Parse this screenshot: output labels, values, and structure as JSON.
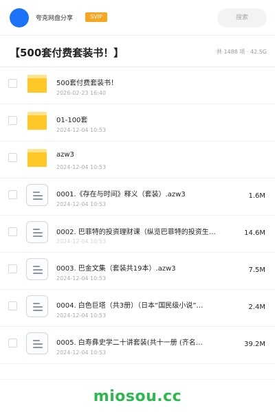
{
  "header": {
    "sharer_name": "夸克网盘分享",
    "vip_badge": "SVIP",
    "search_placeholder": "搜索",
    "accent_color": "#1a73f8"
  },
  "folder": {
    "title": "【500套付费套装书！】",
    "summary": "共 1488 项 · 42.5G"
  },
  "files": [
    {
      "icon": "folder-icon",
      "name": "500套付费套装书！",
      "date": "2026-02-23 16:40",
      "size": ""
    },
    {
      "icon": "folder-icon",
      "name": "01-100套",
      "date": "2024-12-04 10:53",
      "size": ""
    },
    {
      "icon": "folder-icon",
      "name": "azw3",
      "date": "2024-12-04 10:53",
      "size": ""
    },
    {
      "icon": "document-icon",
      "name": "0001.《存在与时间》释义（套装）.azw3",
      "date": "2024-12-04 10:53",
      "size": "1.6M"
    },
    {
      "icon": "document-icon",
      "name": "0002. 巴菲特的投资理财课（纵览巴菲特的投资生…",
      "date": "2024-12-04 10:53",
      "size": "14.6M"
    },
    {
      "icon": "document-icon",
      "name": "0003. 巴金文集（套装共19本）.azw3",
      "date": "2024-12-04 10:53",
      "size": "7.5M"
    },
    {
      "icon": "document-icon",
      "name": "0004. 白色巨塔（共3册）（日本“国民级小说”…",
      "date": "2024-12-04 10:53",
      "size": "2.4M"
    },
    {
      "icon": "document-icon",
      "name": "0005. 白寿彝史学二十讲套装(共十一册 (齐名…",
      "date": "2024-12-04 10:53",
      "size": "39.2M"
    }
  ],
  "footer": {
    "watermark": "miosou.cc",
    "watermark_color": "#2db84d"
  }
}
